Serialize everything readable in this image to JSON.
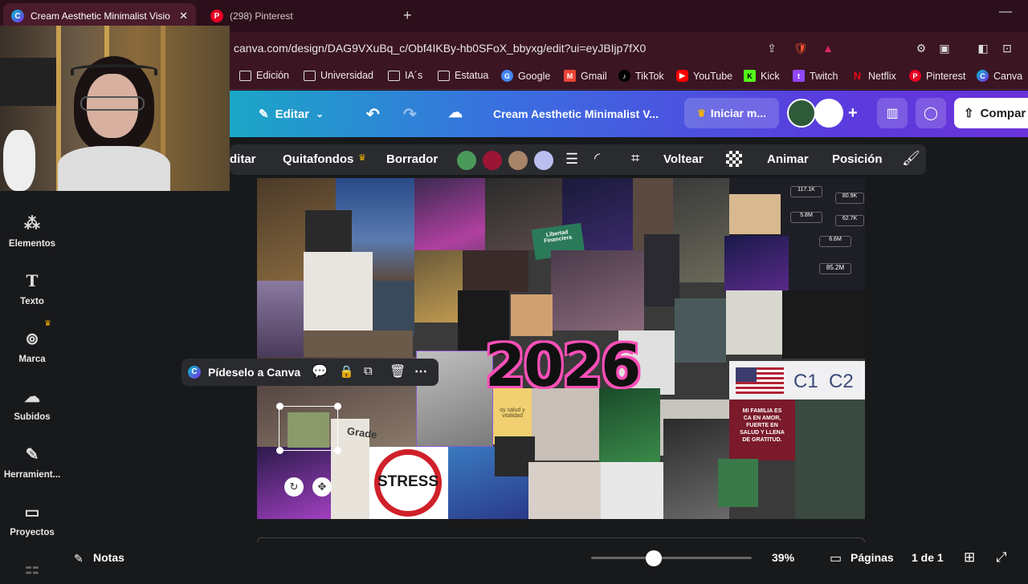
{
  "browser": {
    "tabs": [
      {
        "title": "Cream Aesthetic Minimalist Visio",
        "favicon": "canva-favicon"
      },
      {
        "title": "(298) Pinterest",
        "favicon": "pinterest-favicon"
      }
    ],
    "url": "canva.com/design/DAG9VXuBq_c/Obf4IKBy-hb0SFoX_bbyxg/edit?ui=eyJBIjp7fX0",
    "bookmarks": [
      "Edición",
      "Universidad",
      "IA´s",
      "Estatua",
      "Google",
      "Gmail",
      "TikTok",
      "YouTube",
      "Kick",
      "Twitch",
      "Netflix",
      "Pinterest",
      "Canva"
    ]
  },
  "header": {
    "edit_label": "Editar",
    "doc_title": "Cream Aesthetic Minimalist V...",
    "upgrade_label": "Iniciar m...",
    "share_label": "Compar"
  },
  "toolbar": {
    "edit_partial": "ditar",
    "remove_bg": "Quitafondos",
    "eraser": "Borrador",
    "colors": [
      "#4a9a5a",
      "#9b1535",
      "#a88468",
      "#b9c0ef"
    ],
    "flip": "Voltear",
    "animate": "Animar",
    "position": "Posición"
  },
  "sidebar": {
    "items": [
      {
        "label": "Elementos",
        "icon": "shapes-icon"
      },
      {
        "label": "Texto",
        "icon": "text-icon"
      },
      {
        "label": "Marca",
        "icon": "brand-icon"
      },
      {
        "label": "Subidos",
        "icon": "upload-cloud-icon"
      },
      {
        "label": "Herramient...",
        "icon": "pen-tool-icon"
      },
      {
        "label": "Proyectos",
        "icon": "folder-icon"
      }
    ]
  },
  "context_menu": {
    "ask_canva": "Pídeselo a Canva"
  },
  "collage": {
    "headline": "2026",
    "flag_text": "C1  C2",
    "card_text": "MI FAMILIA ES\nCA EN AMOR,\nFUERTE EN\nSALUD Y LLENA\nDE GRATITUD.",
    "stress_text": "STRESS",
    "grade_text": "Grade",
    "stats": [
      "117.1K",
      "80.9K",
      "5.8M",
      "62.7K",
      "6.6M",
      "85.2M"
    ],
    "sign_text": "Libertad\nFinanciera",
    "health_text": "oy salud y\nvitalidad"
  },
  "bottom": {
    "notes_label": "Notas",
    "zoom": "39%",
    "zoom_level": 0.39,
    "pages_label": "Páginas",
    "page_indicator": "1 de 1"
  }
}
